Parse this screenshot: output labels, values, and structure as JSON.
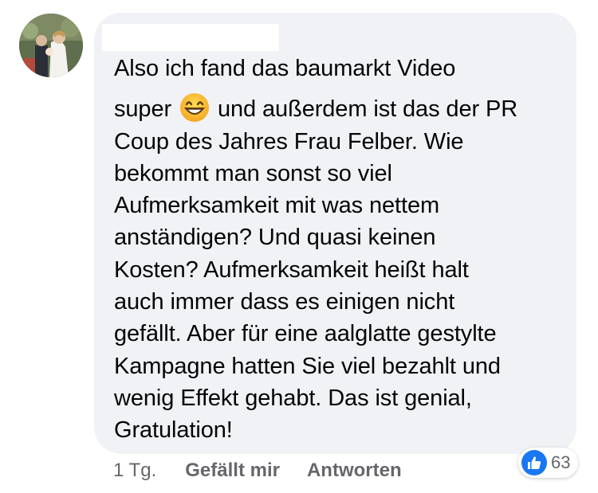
{
  "comment": {
    "lines": [
      "Also ich fand das baumarkt Video",
      "super",
      "und außerdem ist das der PR",
      "Coup des Jahres Frau Felber. Wie",
      "bekommt man sonst so viel",
      "Aufmerksamkeit mit was nettem",
      "anständigen? Und quasi keinen",
      "Kosten? Aufmerksamkeit heißt halt",
      "auch immer dass es einigen nicht",
      "gefällt. Aber für eine aalglatte gestylte",
      "Kampagne hatten Sie viel bezahlt und",
      "wenig Effekt gehabt. Das ist genial,",
      "Gratulation!"
    ],
    "emoji": "grinning-face-with-smiling-eyes-icon"
  },
  "meta": {
    "time": "1 Tg.",
    "like_label": "Gefällt mir",
    "reply_label": "Antworten"
  },
  "reactions": {
    "icon": "thumbs-up-icon",
    "count": "63"
  },
  "colors": {
    "bubble_bg": "#f0f2f5",
    "like_blue": "#1877f2",
    "meta_gray": "#65676b"
  }
}
